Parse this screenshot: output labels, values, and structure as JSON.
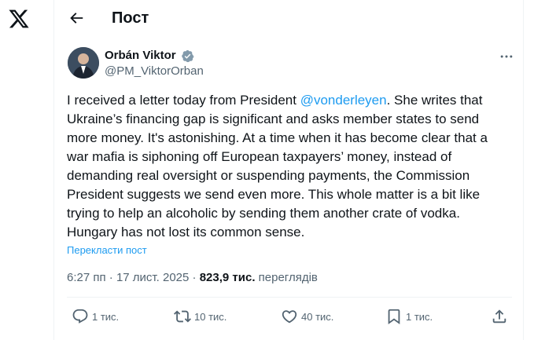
{
  "header": {
    "title": "Пост"
  },
  "author": {
    "name": "Orbán Viktor",
    "handle": "@PM_ViktorOrban"
  },
  "post": {
    "text_before": "I received a letter today from President ",
    "mention": "@vonderleyen",
    "text_after": ". She writes that Ukraine’s financing gap is significant and asks member states to send more money. It's astonishing. At a time when it has become clear that a war mafia is siphoning off European taxpayers’ money, instead of demanding real oversight or suspending payments, the Commission President suggests we send even more. This whole matter is a bit like trying to help an alcoholic by sending them another crate of vodka. Hungary has not lost its common sense.",
    "translate_label": "Перекласти пост"
  },
  "meta": {
    "time": "6:27 пп",
    "separator": " · ",
    "date": "17 лист. 2025",
    "views_count": "823,9 тис.",
    "views_label": "переглядів"
  },
  "actions": {
    "replies": "1 тис.",
    "reposts": "10 тис.",
    "likes": "40 тис.",
    "bookmarks": "1 тис."
  },
  "colors": {
    "accent": "#1d9bf0",
    "secondary_text": "#536471",
    "verified": "#829aab"
  },
  "icons": [
    "x-logo-icon",
    "back-arrow-icon",
    "verified-badge-icon",
    "more-icon",
    "reply-icon",
    "repost-icon",
    "like-icon",
    "bookmark-icon",
    "share-icon"
  ]
}
